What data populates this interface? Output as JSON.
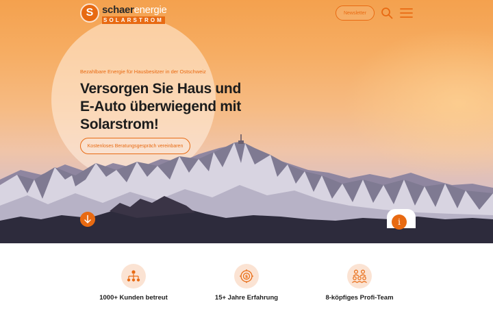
{
  "brand": {
    "logo_letter": "S",
    "name_bold": "schaer",
    "name_light": "energie",
    "tagline": "SOLARSTROM",
    "accent_color": "#e86a12"
  },
  "header": {
    "newsletter_label": "Newsletter",
    "search_icon": "search-icon",
    "menu_icon": "hamburger-menu-icon"
  },
  "hero": {
    "eyebrow": "Bezahlbare Energie für Hausbesitzer in der Ostschweiz",
    "headline": "Versorgen Sie Haus und E-Auto überwiegend mit Solarstrom!",
    "cta_label": "Kostenloses Beratungsgespräch vereinbaren",
    "scroll_icon": "arrow-down-icon",
    "info_icon": "info-icon",
    "info_symbol": "i"
  },
  "features": [
    {
      "icon": "network-icon",
      "label": "1000+ Kunden betreut"
    },
    {
      "icon": "experience-icon",
      "label": "15+ Jahre Erfahrung"
    },
    {
      "icon": "team-icon",
      "label": "8-köpfiges Profi-Team"
    }
  ]
}
